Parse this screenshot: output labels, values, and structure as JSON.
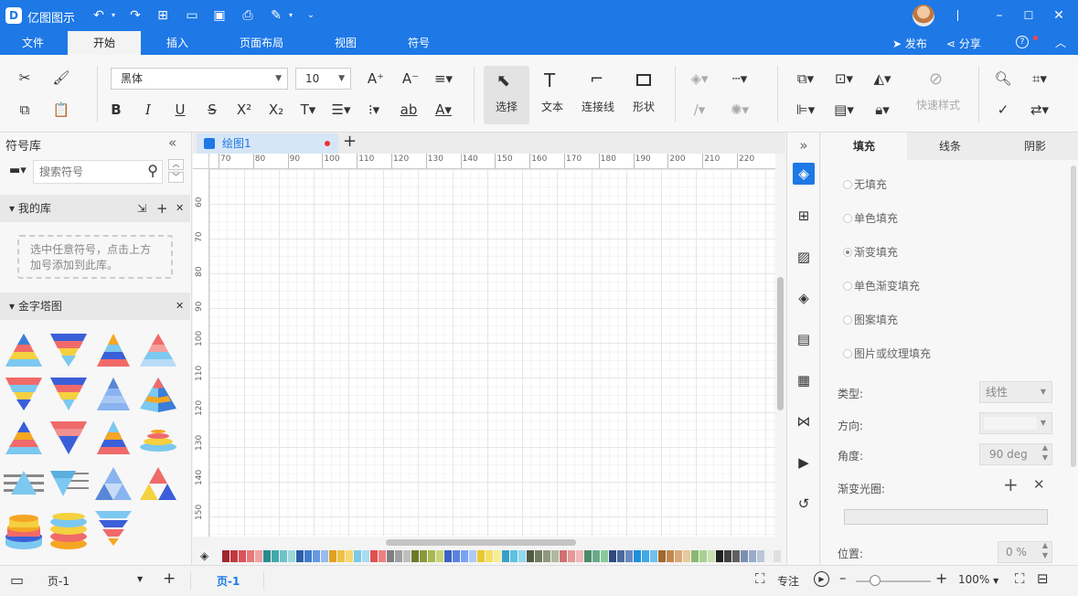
{
  "app": {
    "title": "亿图图示",
    "logo": "D"
  },
  "menu": {
    "tabs": [
      "文件",
      "开始",
      "插入",
      "页面布局",
      "视图",
      "符号"
    ],
    "active": "开始",
    "publish": "发布",
    "share": "分享",
    "help": "?"
  },
  "ribbon": {
    "font_name": "黑体",
    "font_size": "10",
    "select_label": "选择",
    "text_label": "文本",
    "connector_label": "连接线",
    "shape_label": "形状",
    "quick_style_label": "快速样式"
  },
  "library": {
    "title": "符号库",
    "search_placeholder": "搜索符号",
    "my_lib": "我的库",
    "my_lib_hint": "选中任意符号，点击上方加号添加到此库。",
    "pyramid_section": "金字塔图"
  },
  "document": {
    "tab_name": "绘图1",
    "ruler_h": [
      "70",
      "80",
      "90",
      "100",
      "110",
      "120",
      "130",
      "140",
      "150",
      "160",
      "170",
      "180",
      "190",
      "200",
      "210",
      "220"
    ],
    "ruler_v": [
      "60",
      "70",
      "80",
      "90",
      "100",
      "110",
      "120",
      "130",
      "140",
      "150"
    ]
  },
  "fill_panel": {
    "tabs": [
      "填充",
      "线条",
      "阴影"
    ],
    "active": "填充",
    "options": [
      "无填充",
      "单色填充",
      "渐变填充",
      "单色渐变填充",
      "图案填充",
      "图片或纹理填充"
    ],
    "type_label": "类型:",
    "type_value": "线性",
    "direction_label": "方向:",
    "angle_label": "角度:",
    "angle_value": "90 deg",
    "gradient_stops_label": "渐变光圈:",
    "position_label": "位置:",
    "position_value": "0 %"
  },
  "status": {
    "page_select": "页-1",
    "page_tab": "页-1",
    "focus_label": "专注",
    "zoom": "100%"
  },
  "palette": [
    "#a0282d",
    "#c23a3f",
    "#d9545a",
    "#e8787c",
    "#f0a1a3",
    "#2b8a8e",
    "#44a8ad",
    "#6cc3c6",
    "#9dd8da",
    "#2a5ea8",
    "#3f7bd0",
    "#6699e0",
    "#99bbee",
    "#e0a020",
    "#f0c040",
    "#f5d870",
    "#7cc8e8",
    "#a8dcef",
    "#e05050",
    "#f08080",
    "#808080",
    "#a0a0a0",
    "#c0c0c0",
    "#6b7a2a",
    "#8a9a3a",
    "#a8b850",
    "#c8d478",
    "#3a62c0",
    "#5a82e0",
    "#7aa2f0",
    "#b0c8f8",
    "#e8c830",
    "#f5e060",
    "#f8ec98",
    "#38a0c8",
    "#60c0e0",
    "#90d8f0",
    "#505a40",
    "#707a60",
    "#909880",
    "#b0b8a0",
    "#d07070",
    "#e89898",
    "#f0b8b8",
    "#4a8a6a",
    "#6aaa8a",
    "#8aca9a",
    "#304a80",
    "#4a6aa0",
    "#6a8ac0",
    "#1e90d8",
    "#40a8e8",
    "#70c0f0",
    "#a06830",
    "#c08850",
    "#d8a878",
    "#e8c8a0",
    "#8ab870",
    "#a8d090",
    "#c8e0b0",
    "#202020",
    "#404040",
    "#606060",
    "#7a90b0",
    "#98acc8",
    "#b8c8d8",
    "#f0f0f0",
    "#e0e0e0"
  ]
}
